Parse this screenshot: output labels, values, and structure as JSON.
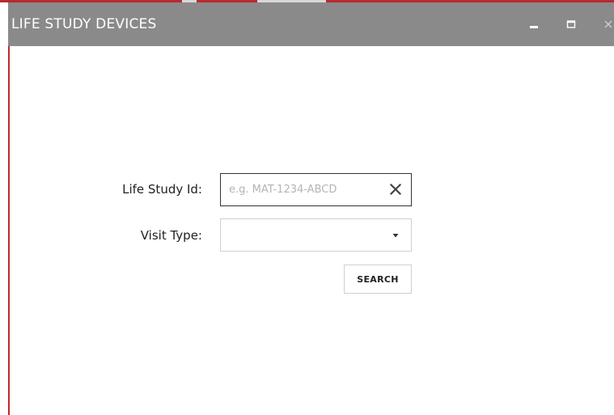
{
  "window": {
    "title": "LIFE STUDY DEVICES",
    "controls": {
      "minimize": "minimize-icon",
      "maximize": "maximize-icon",
      "close": "close-icon"
    },
    "colors": {
      "titlebar": "#8a8a8a",
      "accent": "#c1272d",
      "background": "#ffffff"
    }
  },
  "form": {
    "life_study_id": {
      "label": "Life Study Id:",
      "value": "",
      "placeholder": "e.g. MAT-1234-ABCD",
      "clear_icon": "close-icon"
    },
    "visit_type": {
      "label": "Visit Type:",
      "selected": "",
      "caret_icon": "chevron-down-icon"
    },
    "search_button": {
      "label": "SEARCH"
    }
  }
}
